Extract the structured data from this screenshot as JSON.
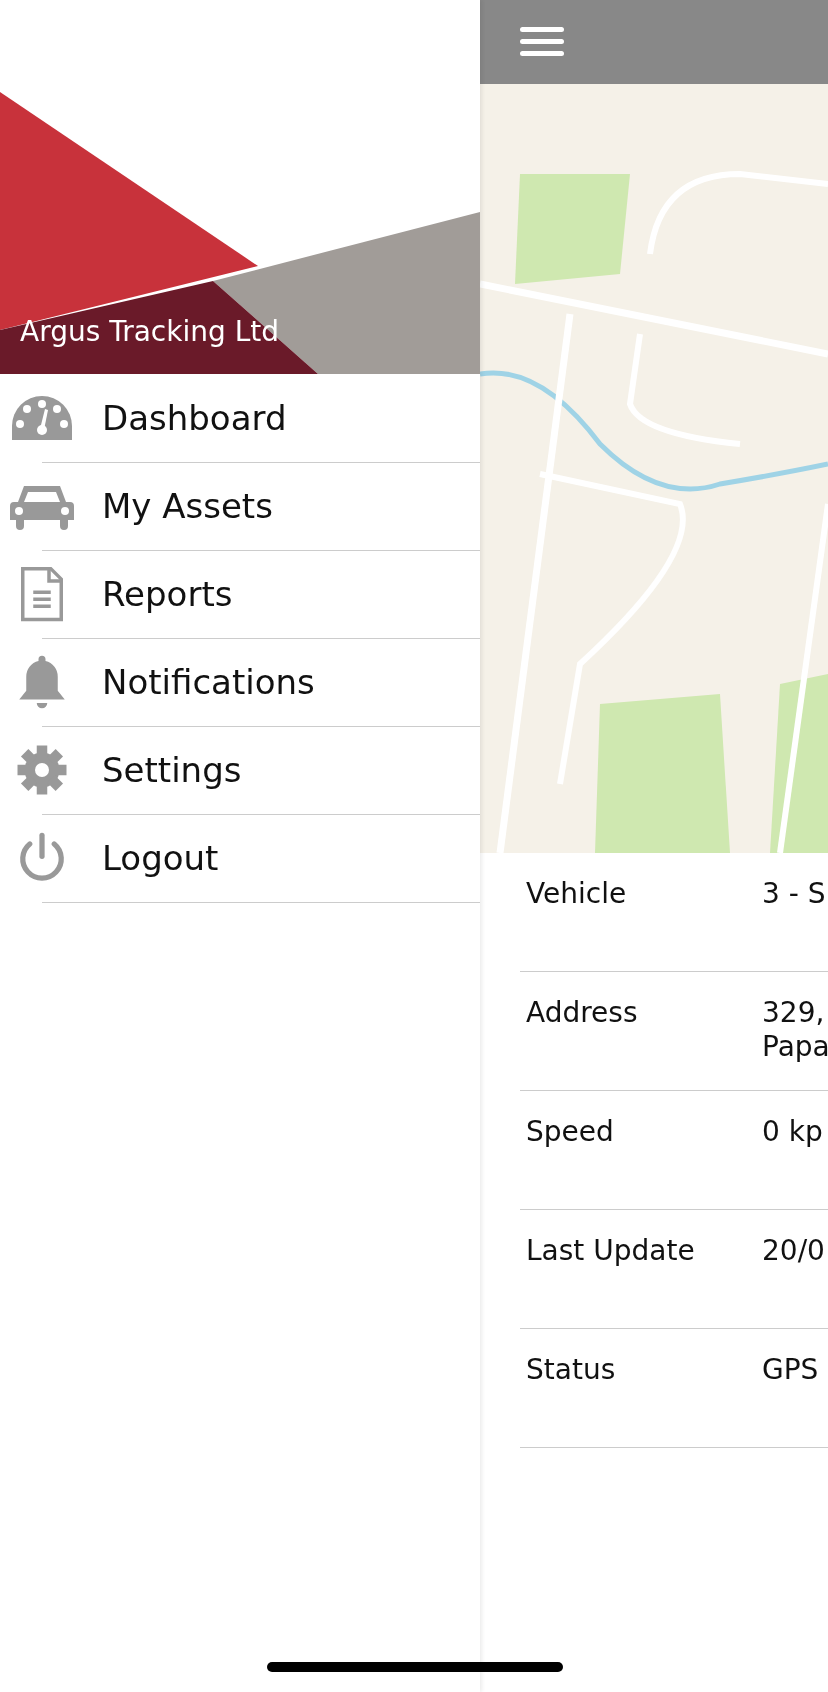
{
  "drawer": {
    "company": "Argus Tracking Ltd",
    "items": [
      {
        "kind": "dashboard",
        "label": "Dashboard"
      },
      {
        "kind": "car",
        "label": "My Assets"
      },
      {
        "kind": "report",
        "label": "Reports"
      },
      {
        "kind": "bell",
        "label": "Notifications"
      },
      {
        "kind": "gear",
        "label": "Settings"
      },
      {
        "kind": "power",
        "label": "Logout"
      }
    ]
  },
  "details": [
    {
      "label": "Vehicle",
      "value": [
        "3 - S"
      ]
    },
    {
      "label": "Address",
      "value": [
        "329,",
        "Papa"
      ]
    },
    {
      "label": "Speed",
      "value": [
        "0 kp"
      ]
    },
    {
      "label": "Last Update",
      "value": [
        "20/0"
      ]
    },
    {
      "label": "Status",
      "value": [
        "GPS"
      ]
    }
  ]
}
